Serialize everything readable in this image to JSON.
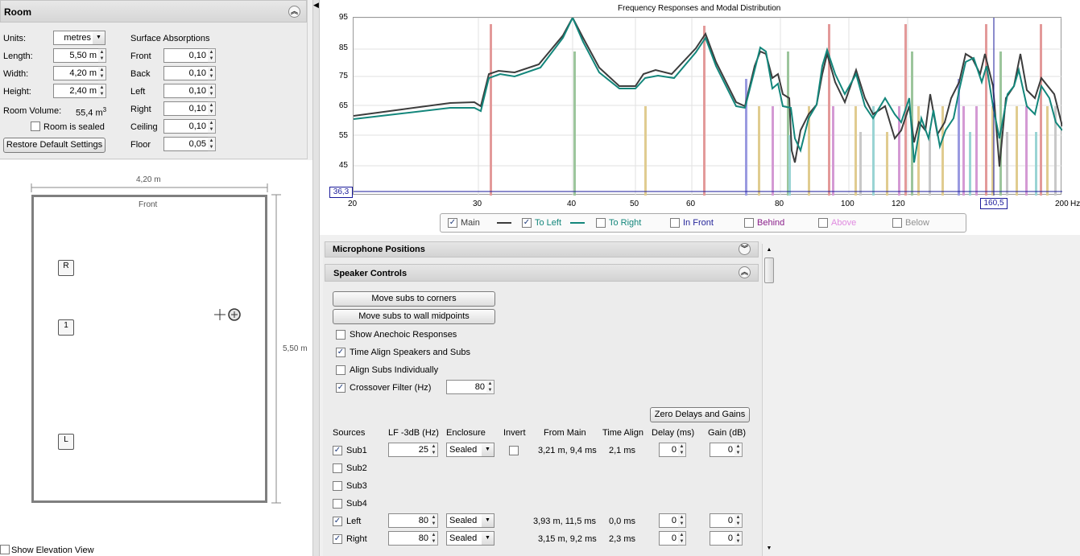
{
  "room": {
    "title": "Room",
    "units_label": "Units:",
    "units_value": "metres",
    "length_label": "Length:",
    "length_value": "5,50 m",
    "width_label": "Width:",
    "width_value": "4,20 m",
    "height_label": "Height:",
    "height_value": "2,40 m",
    "volume_label": "Room Volume:",
    "volume_value": "55,4 m",
    "volume_sup": "3",
    "sealed_label": "Room is sealed",
    "restore_label": "Restore Default Settings",
    "absorptions_title": "Surface Absorptions",
    "absorptions": [
      {
        "label": "Front",
        "value": "0,10"
      },
      {
        "label": "Back",
        "value": "0,10"
      },
      {
        "label": "Left",
        "value": "0,10"
      },
      {
        "label": "Right",
        "value": "0,10"
      },
      {
        "label": "Ceiling",
        "value": "0,10"
      },
      {
        "label": "Floor",
        "value": "0,05"
      }
    ]
  },
  "plan": {
    "width_dim": "4,20 m",
    "length_dim": "5,50 m",
    "front_label": "Front",
    "speakers": [
      {
        "label": "R"
      },
      {
        "label": "1"
      },
      {
        "label": "L"
      }
    ],
    "elevation_label": "Show Elevation View"
  },
  "graph": {
    "title": "Frequency Responses and Modal Distribution",
    "y_ticks": [
      "95",
      "85",
      "75",
      "65",
      "55",
      "45"
    ],
    "x_ticks": [
      "20",
      "30",
      "40",
      "50",
      "60",
      "80",
      "100",
      "120",
      "200"
    ],
    "x_unit": "Hz",
    "cursor_y": "36,3",
    "cursor_x": "160,5",
    "legend": [
      {
        "label": "Main",
        "checked": true,
        "color": "#3c3c3c",
        "line": true
      },
      {
        "label": "To Left",
        "checked": true,
        "color": "#13867b",
        "line": true
      },
      {
        "label": "To Right",
        "checked": false,
        "color": "#13867b"
      },
      {
        "label": "In Front",
        "checked": false,
        "color": "#24249a"
      },
      {
        "label": "Behind",
        "checked": false,
        "color": "#8a1e8a"
      },
      {
        "label": "Above",
        "checked": false,
        "color": "#e08ae0"
      },
      {
        "label": "Below",
        "checked": false,
        "color": "#909090"
      }
    ]
  },
  "controls": {
    "mic_title": "Microphone Positions",
    "speaker_title": "Speaker Controls",
    "move_corners": "Move subs to corners",
    "move_midpoints": "Move subs to wall midpoints",
    "show_anechoic": "Show Anechoic Responses",
    "time_align": "Time Align Speakers and Subs",
    "align_subs": "Align Subs Individually",
    "crossover": "Crossover Filter (Hz)",
    "crossover_value": "80",
    "zero_delays": "Zero Delays and Gains",
    "headers": [
      "Sources",
      "LF -3dB (Hz)",
      "Enclosure",
      "Invert",
      "From Main",
      "Time Align",
      "Delay (ms)",
      "Gain (dB)"
    ],
    "rows": [
      {
        "name": "Sub1",
        "checked": true,
        "lf": "25",
        "enclosure": "Sealed",
        "invert": true,
        "from_main": "3,21 m, 9,4 ms",
        "time_align": "2,1 ms",
        "delay": "0",
        "gain": "0"
      },
      {
        "name": "Sub2",
        "checked": false
      },
      {
        "name": "Sub3",
        "checked": false
      },
      {
        "name": "Sub4",
        "checked": false
      },
      {
        "name": "Left",
        "checked": true,
        "lf": "80",
        "enclosure": "Sealed",
        "from_main": "3,93 m, 11,5 ms",
        "time_align": "0,0 ms",
        "delay": "0",
        "gain": "0"
      },
      {
        "name": "Right",
        "checked": true,
        "lf": "80",
        "enclosure": "Sealed",
        "from_main": "3,15 m, 9,2 ms",
        "time_align": "2,3 ms",
        "delay": "0",
        "gain": "0"
      }
    ]
  }
}
